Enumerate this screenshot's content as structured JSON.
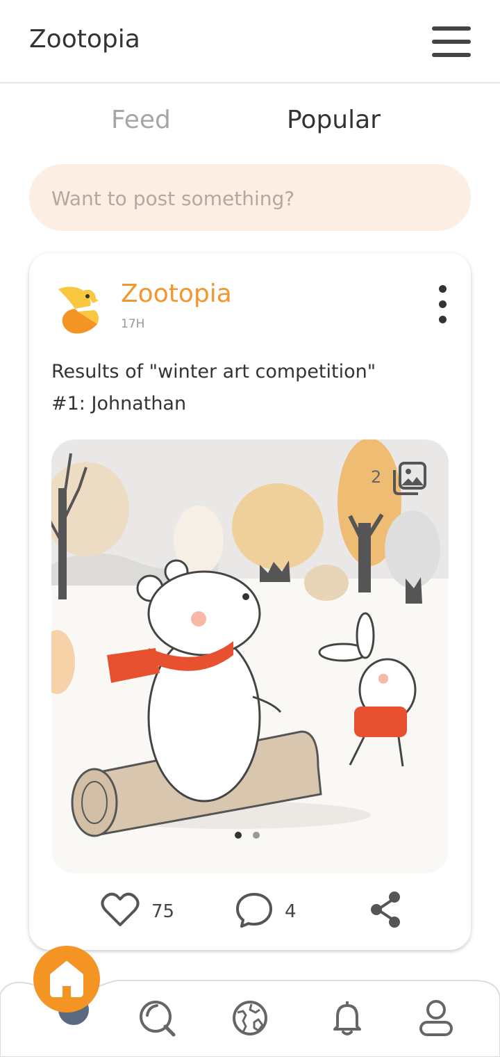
{
  "header": {
    "title": "Zootopia",
    "menu_icon": "hamburger-menu-icon"
  },
  "tabs": [
    {
      "label": "Feed",
      "active": false
    },
    {
      "label": "Popular",
      "active": true
    }
  ],
  "composer": {
    "placeholder": "Want to post something?"
  },
  "post": {
    "author": "Zootopia",
    "time": "17H",
    "avatar_icon": "bird-logo-icon",
    "text_lines": [
      "Results of \"winter art competition\"",
      "#1: Johnathan"
    ],
    "image": {
      "count": "2",
      "current_index": 1,
      "total": 2,
      "description_icon": "gallery-icon"
    },
    "likes": "75",
    "comments": "4",
    "more_icon": "more-vertical-icon"
  },
  "nav": {
    "items": [
      "home",
      "search",
      "explore",
      "notifications",
      "profile"
    ],
    "active": "home"
  },
  "colors": {
    "accent": "#f49424",
    "author": "#f2962d",
    "composer_bg": "#fdeee3",
    "inactive_tab": "#a6a6a6"
  }
}
